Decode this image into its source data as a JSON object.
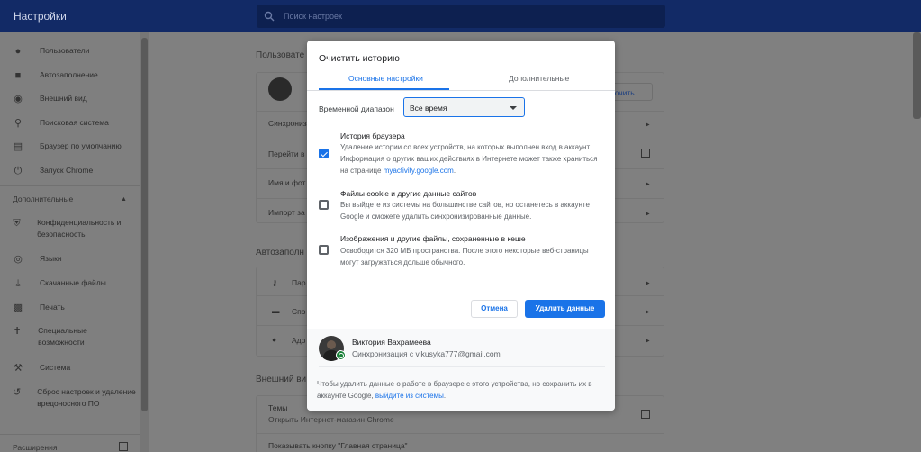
{
  "app": {
    "title": "Настройки",
    "search_placeholder": "Поиск настроек"
  },
  "sidebar": {
    "items": [
      {
        "label": "Пользователи",
        "icon": "person-icon"
      },
      {
        "label": "Автозаполнение",
        "icon": "assignment-icon"
      },
      {
        "label": "Внешний вид",
        "icon": "palette-icon"
      },
      {
        "label": "Поисковая система",
        "icon": "search-icon"
      },
      {
        "label": "Браузер по умолчанию",
        "icon": "browser-icon"
      },
      {
        "label": "Запуск Chrome",
        "icon": "power-icon"
      }
    ],
    "advanced_section": "Дополнительные",
    "advanced_items": [
      {
        "label": "Конфиденциальность и безопасность",
        "icon": "shield-icon"
      },
      {
        "label": "Языки",
        "icon": "globe-icon"
      },
      {
        "label": "Скачанные файлы",
        "icon": "download-icon"
      },
      {
        "label": "Печать",
        "icon": "print-icon"
      },
      {
        "label": "Специальные возможности",
        "icon": "accessibility-icon"
      },
      {
        "label": "Система",
        "icon": "wrench-icon"
      },
      {
        "label": "Сброс настроек и удаление вредоносного ПО",
        "icon": "restore-icon"
      }
    ],
    "extensions": "Расширения"
  },
  "background": {
    "users_section": "Пользовате",
    "sync_row": "Синхрониз",
    "goto_row": "Перейти в",
    "name_row": "Имя и фот",
    "import_row": "Импорт за",
    "enable_sync_button": "ючить",
    "autofill_section": "Автозаполн",
    "passwords_row": "Пар",
    "payment_row": "Спо",
    "addresses_row": "Адр",
    "appearance_section": "Внешний ви",
    "themes_title": "Темы",
    "themes_sub": "Открыть Интернет-магазин Chrome",
    "home_button": "Показывать кнопку \"Главная страница\""
  },
  "dialog": {
    "title": "Очистить историю",
    "tabs": {
      "basic": "Основные настройки",
      "advanced": "Дополнительные"
    },
    "time_range": {
      "label": "Временной диапазон",
      "value": "Все время"
    },
    "options": [
      {
        "title": "История браузера",
        "desc": "Удаление истории со всех устройств, на которых выполнен вход в аккаунт. Информация о других ваших действиях в Интернете может также храниться на странице ",
        "link": "myactivity.google.com",
        "desc_end": ".",
        "checked": true
      },
      {
        "title": "Файлы cookie и другие данные сайтов",
        "desc": "Вы выйдете из системы на большинстве сайтов, но останетесь в аккаунте Google и сможете удалить синхронизированные данные.",
        "checked": false
      },
      {
        "title": "Изображения и другие файлы, сохраненные в кеше",
        "desc": "Освободится 320 МБ пространства. После этого некоторые веб-страницы могут загружаться дольше обычного.",
        "checked": false
      }
    ],
    "cancel_label": "Отмена",
    "delete_label": "Удалить данные",
    "account": {
      "name": "Виктория Вахрамеева",
      "sync_text": "Синхронизация с vikusyka777@gmail.com"
    },
    "footer_note": "Чтобы удалить данные о работе в браузере с этого устройства, но сохранить их в аккаунте Google, ",
    "footer_link": "выйдите из системы",
    "footer_end": "."
  },
  "colors": {
    "accent": "#1a73e8",
    "header": "#122a66",
    "sync_green": "#188038"
  }
}
